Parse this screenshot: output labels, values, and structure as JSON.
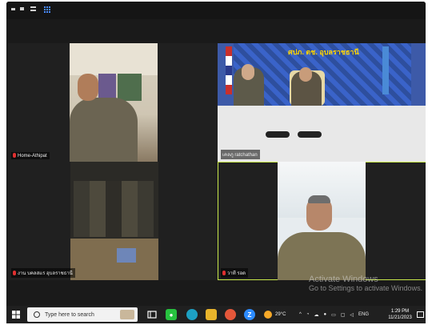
{
  "participants": [
    {
      "name": "Home-Athipat"
    },
    {
      "name": "เคลภู ratchathan"
    },
    {
      "name": "งาน บคลสแร อุบลราชธานี"
    },
    {
      "name": "วาที รอด"
    }
  ],
  "video_text": {
    "banner": "ศปภ. ตช. อุบลราชธานี"
  },
  "watermark": {
    "title": "Activate Windows",
    "subtitle": "Go to Settings to activate Windows."
  },
  "taskbar": {
    "search_placeholder": "Type here to search",
    "weather_temp": "29°C",
    "language": "ENG",
    "time": "1:29 PM",
    "date": "11/21/2023"
  },
  "colors": {
    "screen_bg": "#1a1a1a",
    "active_speaker_border": "#c8e84a",
    "muted_mic": "#e03030",
    "taskbar_bg": "#202020"
  }
}
